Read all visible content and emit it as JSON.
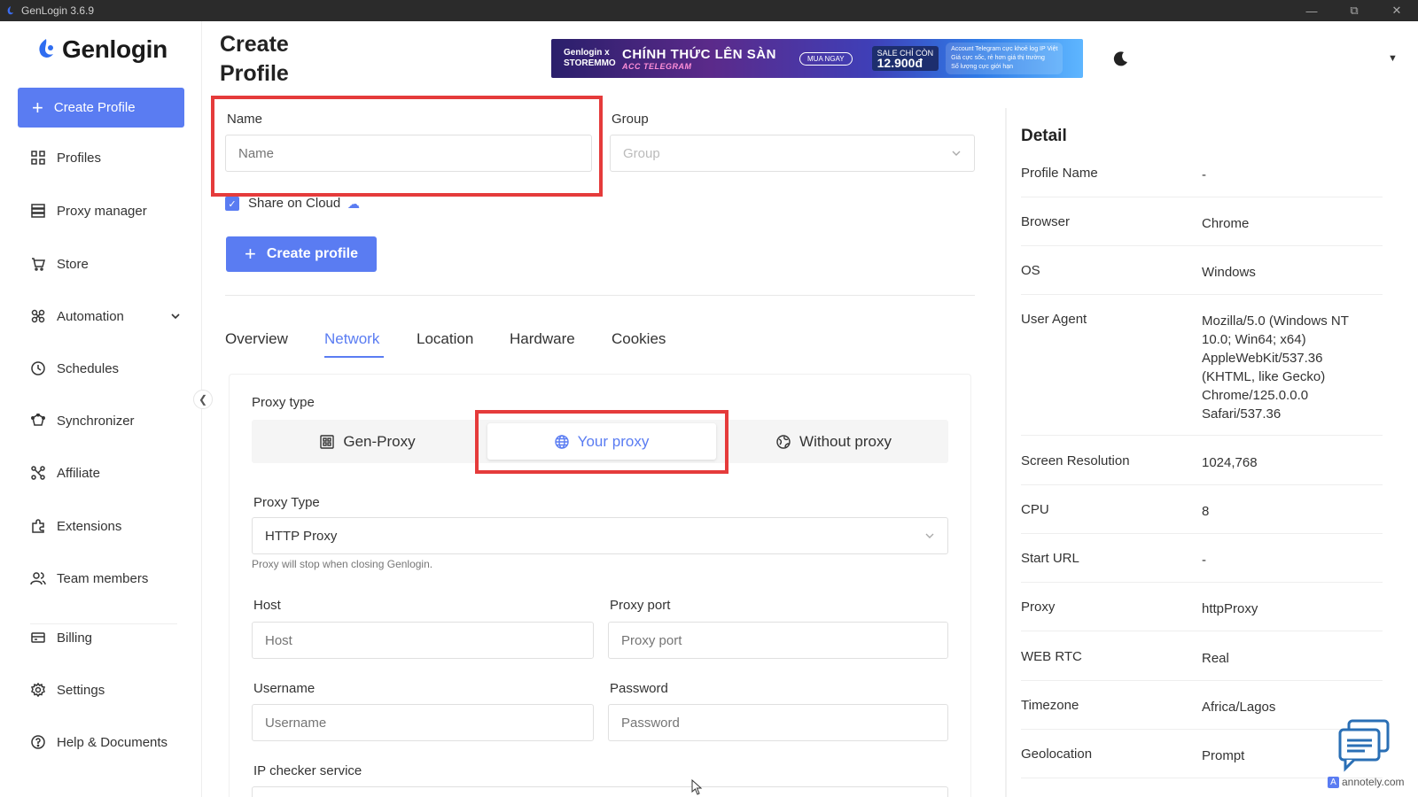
{
  "window": {
    "title": "GenLogin 3.6.9"
  },
  "sidebar": {
    "logo": "Genlogin",
    "create_button": "Create Profile",
    "items": [
      {
        "label": "Profiles",
        "icon": "grid-icon"
      },
      {
        "label": "Proxy manager",
        "icon": "server-icon"
      },
      {
        "label": "Store",
        "icon": "cart-icon"
      },
      {
        "label": "Automation",
        "icon": "automation-icon"
      },
      {
        "label": "Schedules",
        "icon": "clock-icon"
      },
      {
        "label": "Synchronizer",
        "icon": "sync-icon"
      },
      {
        "label": "Affiliate",
        "icon": "affiliate-icon"
      },
      {
        "label": "Extensions",
        "icon": "puzzle-icon"
      },
      {
        "label": "Team members",
        "icon": "team-icon"
      },
      {
        "label": "Billing",
        "icon": "card-icon"
      },
      {
        "label": "Settings",
        "icon": "gear-icon"
      },
      {
        "label": "Help & Documents",
        "icon": "help-icon"
      }
    ]
  },
  "header": {
    "title": "Create Profile",
    "banner": {
      "brand": "Genlogin x STOREMMO",
      "headline": "CHÍNH THỨC LÊN SÀN",
      "sub": "ACC TELEGRAM",
      "cta": "MUA NGAY",
      "sale_label": "SALE CHỈ CÒN",
      "price": "12.900đ",
      "notes": [
        "Account Telegram cực khoẻ log IP Việt",
        "Giá cực sốc, rẻ hơn giá thị trường",
        "Số lượng cực giới hạn"
      ]
    }
  },
  "form": {
    "name_label": "Name",
    "name_placeholder": "Name",
    "group_label": "Group",
    "group_placeholder": "Group",
    "share_label": "Share on Cloud",
    "share_checked": true,
    "create_button": "Create profile"
  },
  "tabs": [
    "Overview",
    "Network",
    "Location",
    "Hardware",
    "Cookies"
  ],
  "active_tab": "Network",
  "network": {
    "proxy_type_label": "Proxy type",
    "options": [
      "Gen-Proxy",
      "Your proxy",
      "Without proxy"
    ],
    "selected_option": "Your proxy",
    "proxy_type_select_label": "Proxy Type",
    "proxy_type_value": "HTTP Proxy",
    "hint": "Proxy will stop when closing Genlogin.",
    "host_label": "Host",
    "host_placeholder": "Host",
    "port_label": "Proxy port",
    "port_placeholder": "Proxy port",
    "username_label": "Username",
    "username_placeholder": "Username",
    "password_label": "Password",
    "password_placeholder": "Password",
    "ip_checker_label": "IP checker service"
  },
  "detail": {
    "title": "Detail",
    "rows": [
      {
        "key": "Profile Name",
        "value": "-"
      },
      {
        "key": "Browser",
        "value": "Chrome"
      },
      {
        "key": "OS",
        "value": "Windows"
      },
      {
        "key": "User Agent",
        "value": "Mozilla/5.0 (Windows NT 10.0; Win64; x64) AppleWebKit/537.36 (KHTML, like Gecko) Chrome/125.0.0.0 Safari/537.36"
      },
      {
        "key": "Screen Resolution",
        "value": "1024,768"
      },
      {
        "key": "CPU",
        "value": "8"
      },
      {
        "key": "Start URL",
        "value": "-"
      },
      {
        "key": "Proxy",
        "value": "httpProxy"
      },
      {
        "key": "WEB RTC",
        "value": "Real"
      },
      {
        "key": "Timezone",
        "value": "Africa/Lagos"
      },
      {
        "key": "Geolocation",
        "value": "Prompt"
      }
    ]
  },
  "watermark": "annotely.com",
  "colors": {
    "accent": "#5a7cf2",
    "highlight": "#e53b3b"
  }
}
